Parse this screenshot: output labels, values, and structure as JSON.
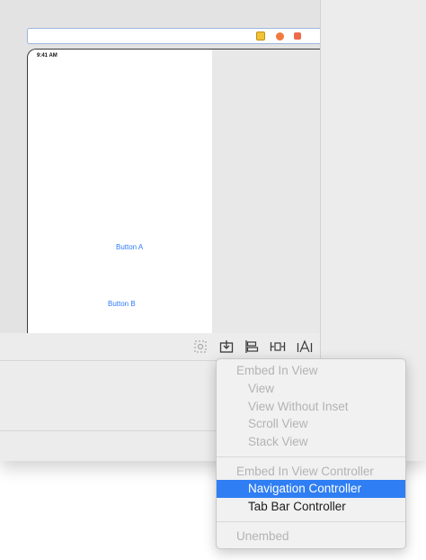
{
  "canvas": {
    "status_time": "9:41 AM",
    "button_a": "Button A",
    "button_b": "Button B"
  },
  "toolbar": {
    "icons": [
      "update-frames-icon",
      "embed-in-icon",
      "align-icon",
      "add-constraints-icon",
      "resolve-issues-icon"
    ]
  },
  "menu": {
    "embed_in_view": "Embed In View",
    "view": "View",
    "view_without_inset": "View Without Inset",
    "scroll_view": "Scroll View",
    "stack_view": "Stack View",
    "embed_in_view_controller": "Embed In View Controller",
    "navigation_controller": "Navigation Controller",
    "tab_bar_controller": "Tab Bar Controller",
    "unembed": "Unembed"
  },
  "colors": {
    "accent": "#2f7ef3",
    "link_blue": "#2f7cf6",
    "disabled_text": "#b3b3b3"
  }
}
